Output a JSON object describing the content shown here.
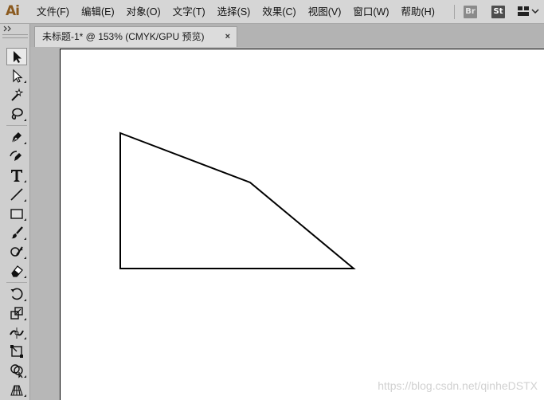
{
  "app": {
    "logo": "Ai"
  },
  "menu": {
    "items": [
      {
        "label": "文件(F)"
      },
      {
        "label": "编辑(E)"
      },
      {
        "label": "对象(O)"
      },
      {
        "label": "文字(T)"
      },
      {
        "label": "选择(S)"
      },
      {
        "label": "效果(C)"
      },
      {
        "label": "视图(V)"
      },
      {
        "label": "窗口(W)"
      },
      {
        "label": "帮助(H)"
      }
    ],
    "bridge_icon": "Br",
    "stock_icon": "St"
  },
  "document": {
    "tab_title": "未标题-1* @ 153% (CMYK/GPU 预览)",
    "close_glyph": "×"
  },
  "tools": [
    {
      "name": "selection-tool",
      "icon": "arrow-black"
    },
    {
      "name": "direct-selection-tool",
      "icon": "arrow-white"
    },
    {
      "name": "magic-wand-tool",
      "icon": "magic-wand"
    },
    {
      "name": "lasso-tool",
      "icon": "lasso"
    },
    {
      "name": "pen-tool",
      "icon": "pen"
    },
    {
      "name": "curvature-tool",
      "icon": "curvature-pen"
    },
    {
      "name": "type-tool",
      "icon": "type-T"
    },
    {
      "name": "line-segment-tool",
      "icon": "line"
    },
    {
      "name": "rectangle-tool",
      "icon": "rectangle"
    },
    {
      "name": "paintbrush-tool",
      "icon": "brush"
    },
    {
      "name": "shaper-tool",
      "icon": "shaper"
    },
    {
      "name": "eraser-tool",
      "icon": "eraser"
    },
    {
      "name": "rotate-tool",
      "icon": "rotate"
    },
    {
      "name": "scale-tool",
      "icon": "scale"
    },
    {
      "name": "width-tool",
      "icon": "width"
    },
    {
      "name": "free-transform-tool",
      "icon": "free-transform"
    },
    {
      "name": "shape-builder-tool",
      "icon": "shape-builder"
    },
    {
      "name": "perspective-grid-tool",
      "icon": "perspective-grid"
    }
  ],
  "artwork": {
    "shape": "quadrilateral",
    "stroke": "#000000",
    "fill": "#ffffff"
  },
  "watermark": "https://blog.csdn.net/qinheDSTX"
}
